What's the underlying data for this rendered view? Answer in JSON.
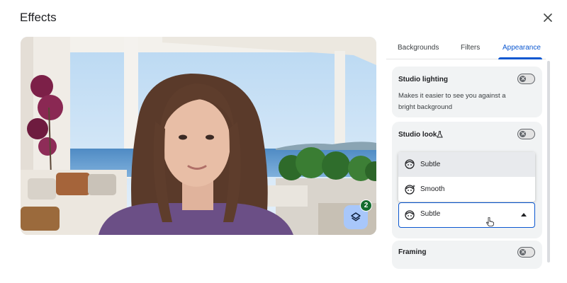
{
  "dialog": {
    "title": "Effects",
    "close_icon": "close-icon"
  },
  "preview": {
    "layers_badge": "2",
    "layers_icon": "layers-icon"
  },
  "tabs": [
    {
      "label": "Backgrounds",
      "active": false
    },
    {
      "label": "Filters",
      "active": false
    },
    {
      "label": "Appearance",
      "active": true
    }
  ],
  "cards": {
    "studio_lighting": {
      "title": "Studio lighting",
      "description": "Makes it easier to see you against a bright background",
      "enabled": false
    },
    "studio_look": {
      "title": "Studio look",
      "badge_icon": "flask-icon",
      "enabled": false
    },
    "framing": {
      "title": "Framing",
      "enabled": false
    }
  },
  "dropdown": {
    "selected": "Subtle",
    "options": [
      {
        "label": "Subtle",
        "icon": "face-subtle-icon",
        "selected": true
      },
      {
        "label": "Smooth",
        "icon": "face-smooth-icon",
        "selected": false
      }
    ]
  },
  "colors": {
    "accent": "#0b57d0",
    "badge": "#146c2e",
    "layers_button": "#a8c7fa"
  }
}
